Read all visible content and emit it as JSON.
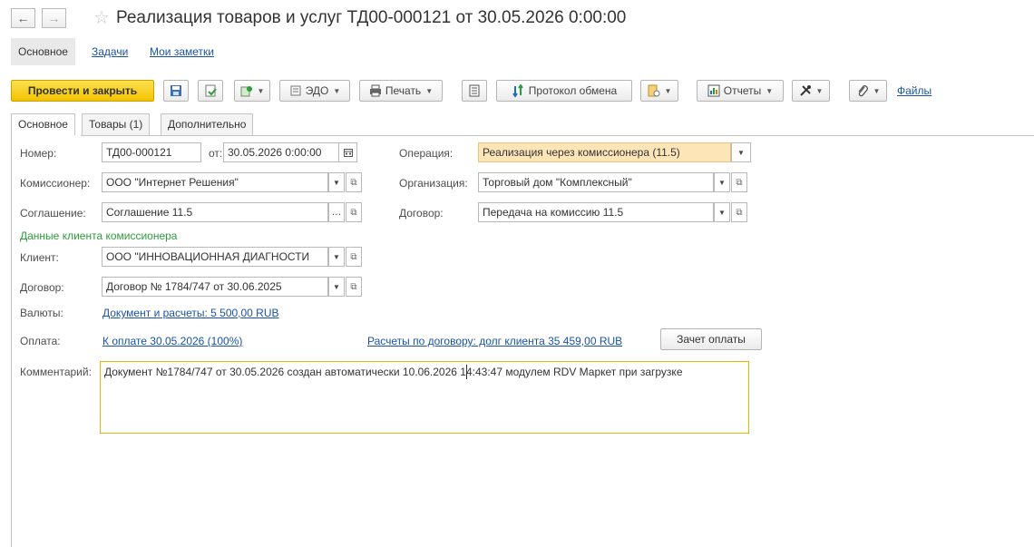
{
  "window": {
    "back_glyph": "←",
    "forward_glyph": "→",
    "favorite_glyph": "☆",
    "title": "Реализация товаров и услуг ТД00-000121 от 30.05.2026 0:00:00"
  },
  "sections": {
    "main": "Основное",
    "tasks": "Задачи",
    "notes": "Мои заметки"
  },
  "toolbar": {
    "post_close": "Провести и закрыть",
    "edo": "ЭДО",
    "print": "Печать",
    "exchange_protocol": "Протокол обмена",
    "reports": "Отчеты",
    "files": "Файлы"
  },
  "tabs": [
    "Основное",
    "Товары (1)",
    "Дополнительно"
  ],
  "form": {
    "number_label": "Номер:",
    "number_value": "ТД00-000121",
    "date_label": "от:",
    "date_value": "30.05.2026  0:00:00",
    "operation_label": "Операция:",
    "operation_value": "Реализация через комиссионера (11.5)",
    "commissioner_label": "Комиссионер:",
    "commissioner_value": "ООО \"Интернет Решения\"",
    "organization_label": "Организация:",
    "organization_value": "Торговый дом \"Комплексный\"",
    "agreement_label": "Соглашение:",
    "agreement_value": "Соглашение 11.5",
    "contract_label": "Договор:",
    "contract_value": "Передача на комиссию 11.5",
    "client_data_header": "Данные клиента комиссионера",
    "client_label": "Клиент:",
    "client_value": "ООО \"ИННОВАЦИОННАЯ ДИАГНОСТИ",
    "client_contract_label": "Договор:",
    "client_contract_value": "Договор № 1784/747 от 30.06.2025",
    "currency_label": "Валюты:",
    "currency_link": "Документ и расчеты: 5 500,00 RUB",
    "payment_label": "Оплата:",
    "payment_link": "К оплате 30.05.2026 (100%)",
    "settlements_link": "Расчеты по договору: долг клиента 35 459,00 RUB",
    "offset_button": "Зачет оплаты",
    "comment_label": "Комментарий:",
    "comment_value": "Документ №1784/747 от 30.05.2026 создан автоматически 10.06.2026 14:43:47 модулем RDV Маркет при загрузке"
  }
}
